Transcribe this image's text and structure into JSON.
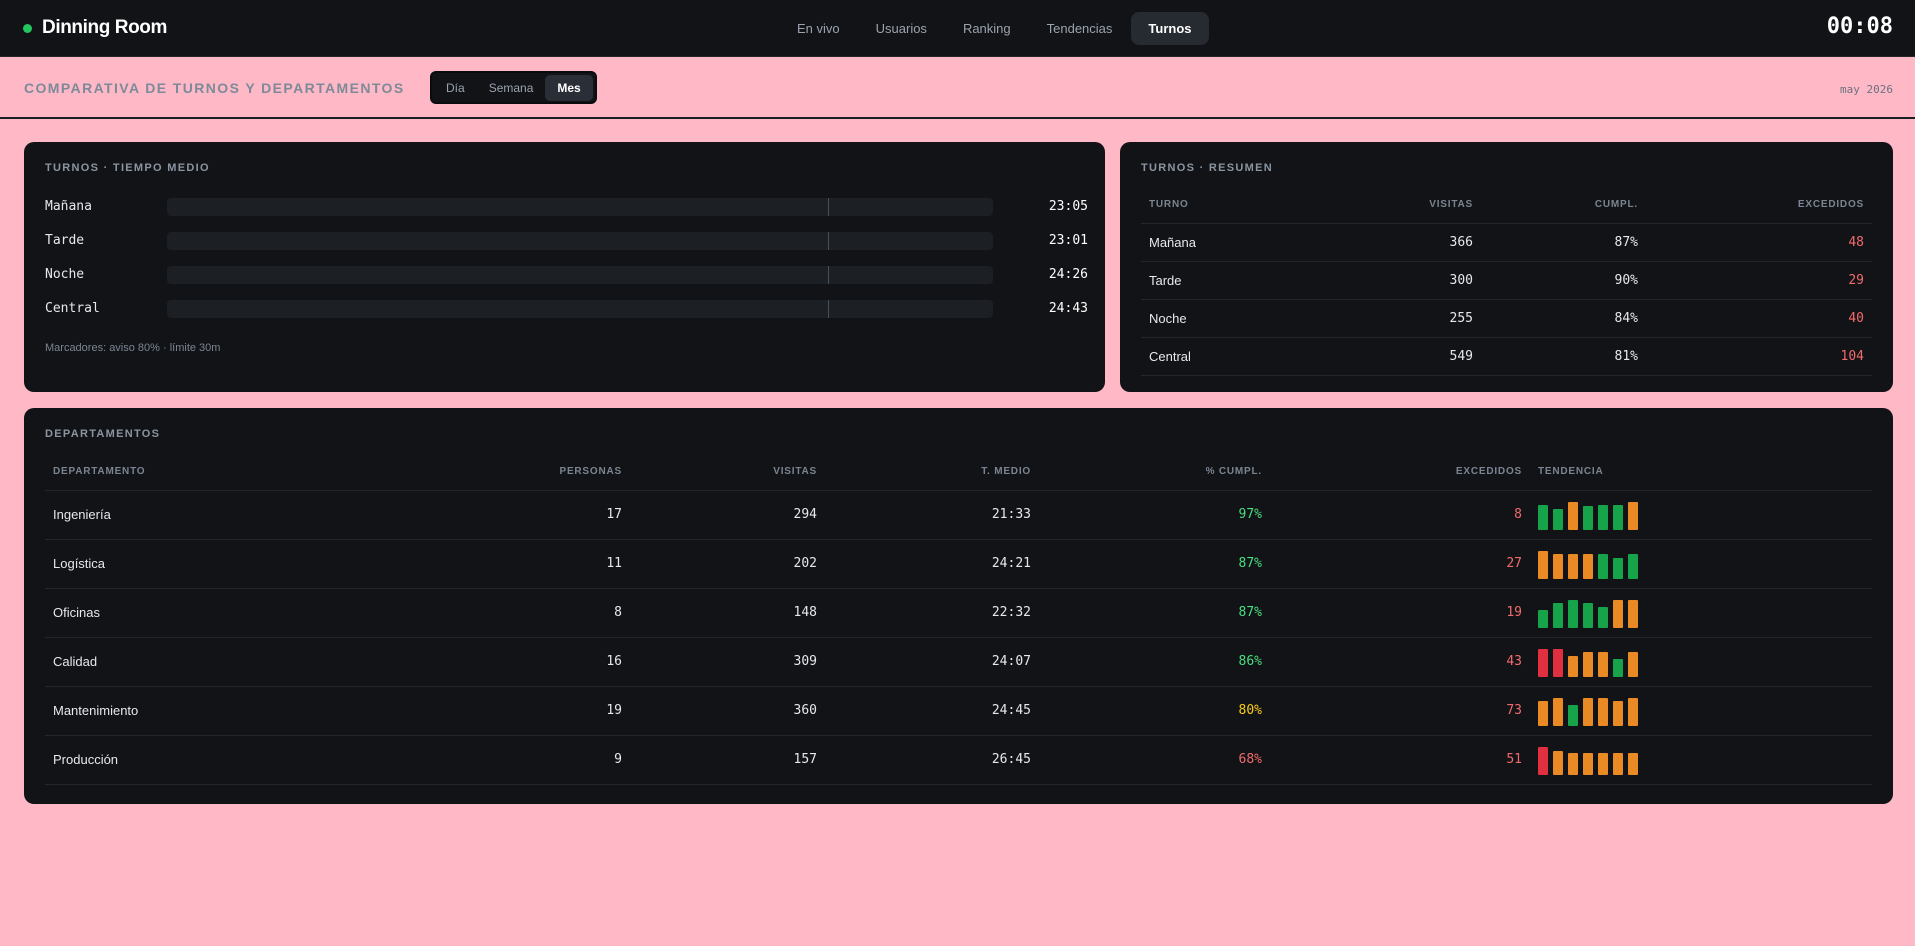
{
  "app": {
    "name": "Dinning Room",
    "clock": "00:08"
  },
  "nav": {
    "tabs": [
      {
        "label": "En vivo",
        "active": false
      },
      {
        "label": "Usuarios",
        "active": false
      },
      {
        "label": "Ranking",
        "active": false
      },
      {
        "label": "Tendencias",
        "active": false
      },
      {
        "label": "Turnos",
        "active": true
      }
    ]
  },
  "header": {
    "title": "COMPARATIVA DE TURNOS Y DEPARTAMENTOS",
    "ranges": [
      {
        "label": "Día",
        "active": false
      },
      {
        "label": "Semana",
        "active": false
      },
      {
        "label": "Mes",
        "active": true
      }
    ],
    "period": "may 2026"
  },
  "shift_times": {
    "title": "TURNOS · TIEMPO MEDIO",
    "rows": [
      {
        "label": "Mañana",
        "value": "23:05"
      },
      {
        "label": "Tarde",
        "value": "23:01"
      },
      {
        "label": "Noche",
        "value": "24:26"
      },
      {
        "label": "Central",
        "value": "24:43"
      }
    ],
    "marker_fraction": 0.8,
    "footnote": "Marcadores: aviso 80% · límite 30m"
  },
  "shift_summary": {
    "title": "TURNOS · RESUMEN",
    "columns": [
      "TURNO",
      "VISITAS",
      "CUMPL.",
      "EXCEDIDOS"
    ],
    "rows": [
      {
        "turno": "Mañana",
        "visitas": "366",
        "cumpl": "87%",
        "excedidos": "48"
      },
      {
        "turno": "Tarde",
        "visitas": "300",
        "cumpl": "90%",
        "excedidos": "29"
      },
      {
        "turno": "Noche",
        "visitas": "255",
        "cumpl": "84%",
        "excedidos": "40"
      },
      {
        "turno": "Central",
        "visitas": "549",
        "cumpl": "81%",
        "excedidos": "104"
      }
    ]
  },
  "departments": {
    "title": "DEPARTAMENTOS",
    "columns": [
      "DEPARTAMENTO",
      "PERSONAS",
      "VISITAS",
      "T. MEDIO",
      "% CUMPL.",
      "EXCEDIDOS",
      "TENDENCIA"
    ],
    "colors": {
      "green": "#16a34a",
      "orange": "#ea8a25",
      "red": "#e0303f"
    },
    "rows": [
      {
        "name": "Ingeniería",
        "personas": "17",
        "visitas": "294",
        "tmedio": "21:33",
        "cumpl": "97%",
        "cumpl_status": "green",
        "excedidos": "8",
        "trend": [
          {
            "h": 0.9,
            "c": "green"
          },
          {
            "h": 0.75,
            "c": "green"
          },
          {
            "h": 1,
            "c": "orange"
          },
          {
            "h": 0.85,
            "c": "green"
          },
          {
            "h": 0.9,
            "c": "green"
          },
          {
            "h": 0.9,
            "c": "green"
          },
          {
            "h": 1,
            "c": "orange"
          }
        ]
      },
      {
        "name": "Logística",
        "personas": "11",
        "visitas": "202",
        "tmedio": "24:21",
        "cumpl": "87%",
        "cumpl_status": "green",
        "excedidos": "27",
        "trend": [
          {
            "h": 1,
            "c": "orange"
          },
          {
            "h": 0.9,
            "c": "orange"
          },
          {
            "h": 0.9,
            "c": "orange"
          },
          {
            "h": 0.9,
            "c": "orange"
          },
          {
            "h": 0.9,
            "c": "green"
          },
          {
            "h": 0.75,
            "c": "green"
          },
          {
            "h": 0.9,
            "c": "green"
          }
        ]
      },
      {
        "name": "Oficinas",
        "personas": "8",
        "visitas": "148",
        "tmedio": "22:32",
        "cumpl": "87%",
        "cumpl_status": "green",
        "excedidos": "19",
        "trend": [
          {
            "h": 0.65,
            "c": "green"
          },
          {
            "h": 0.9,
            "c": "green"
          },
          {
            "h": 1,
            "c": "green"
          },
          {
            "h": 0.9,
            "c": "green"
          },
          {
            "h": 0.75,
            "c": "green"
          },
          {
            "h": 1,
            "c": "orange"
          },
          {
            "h": 1,
            "c": "orange"
          }
        ]
      },
      {
        "name": "Calidad",
        "personas": "16",
        "visitas": "309",
        "tmedio": "24:07",
        "cumpl": "86%",
        "cumpl_status": "green",
        "excedidos": "43",
        "trend": [
          {
            "h": 1,
            "c": "red"
          },
          {
            "h": 1,
            "c": "red"
          },
          {
            "h": 0.75,
            "c": "orange"
          },
          {
            "h": 0.9,
            "c": "orange"
          },
          {
            "h": 0.9,
            "c": "orange"
          },
          {
            "h": 0.65,
            "c": "green"
          },
          {
            "h": 0.9,
            "c": "orange"
          }
        ]
      },
      {
        "name": "Mantenimiento",
        "personas": "19",
        "visitas": "360",
        "tmedio": "24:45",
        "cumpl": "80%",
        "cumpl_status": "amber",
        "excedidos": "73",
        "trend": [
          {
            "h": 0.9,
            "c": "orange"
          },
          {
            "h": 1,
            "c": "orange"
          },
          {
            "h": 0.75,
            "c": "green"
          },
          {
            "h": 1,
            "c": "orange"
          },
          {
            "h": 1,
            "c": "orange"
          },
          {
            "h": 0.9,
            "c": "orange"
          },
          {
            "h": 1,
            "c": "orange"
          }
        ]
      },
      {
        "name": "Producción",
        "personas": "9",
        "visitas": "157",
        "tmedio": "26:45",
        "cumpl": "68%",
        "cumpl_status": "red",
        "excedidos": "51",
        "trend": [
          {
            "h": 1,
            "c": "red"
          },
          {
            "h": 0.85,
            "c": "orange"
          },
          {
            "h": 0.8,
            "c": "orange"
          },
          {
            "h": 0.8,
            "c": "orange"
          },
          {
            "h": 0.8,
            "c": "orange"
          },
          {
            "h": 0.8,
            "c": "orange"
          },
          {
            "h": 0.8,
            "c": "orange"
          }
        ]
      }
    ]
  }
}
